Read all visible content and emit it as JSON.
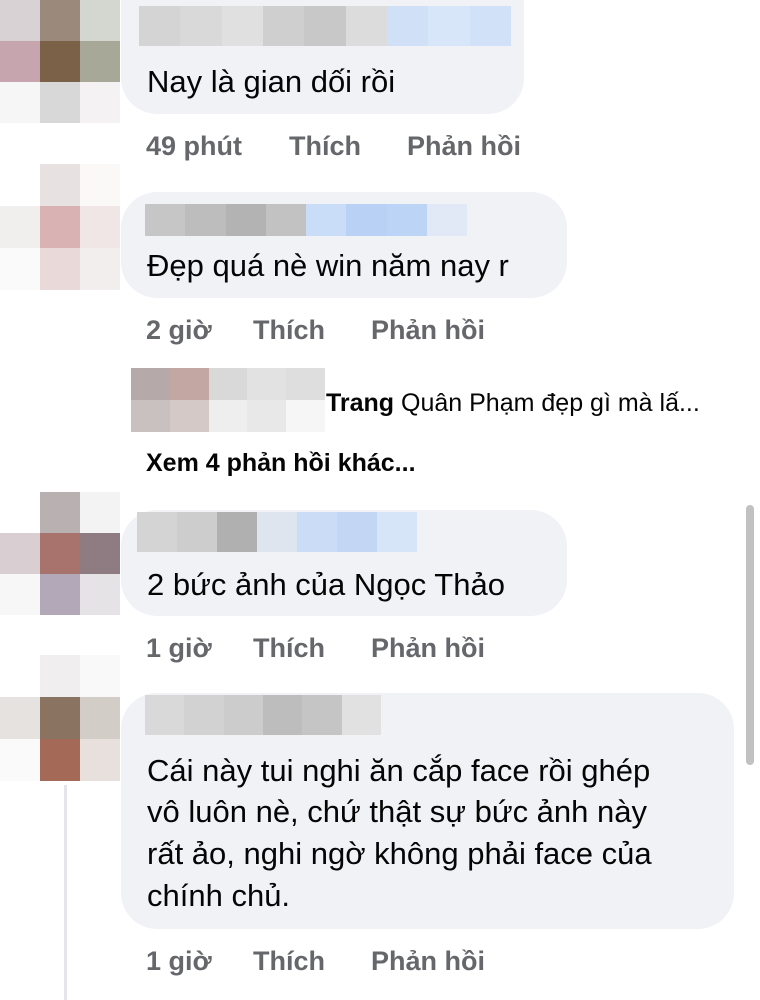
{
  "comments": [
    {
      "text": "Nay là gian dối rồi",
      "time": "49 phút",
      "like_label": "Thích",
      "reply_label": "Phản hồi"
    },
    {
      "text": "Đẹp quá nè win năm nay r",
      "time": "2 giờ",
      "like_label": "Thích",
      "reply_label": "Phản hồi",
      "reply_preview": {
        "author": "Trang",
        "text": "Quân Phạm đẹp gì mà lấ..."
      },
      "see_more": "Xem 4 phản hồi khác..."
    },
    {
      "text": "2 bức ảnh của Ngọc Thảo",
      "time": "1 giờ",
      "like_label": "Thích",
      "reply_label": "Phản hồi"
    },
    {
      "lines": [
        "Cái này tui nghi ăn cắp face rồi ghép",
        "vô luôn nè, chứ thật sự bức ảnh này",
        "rất ảo, nghi ngờ không phải face của",
        "chính chủ."
      ],
      "time": "1 giờ",
      "like_label": "Thích",
      "reply_label": "Phản hồi"
    }
  ],
  "colors": {
    "bubble": "#f0f2f5",
    "meta_text": "#65676b",
    "name_blur_blue": "#c9dcf5"
  }
}
